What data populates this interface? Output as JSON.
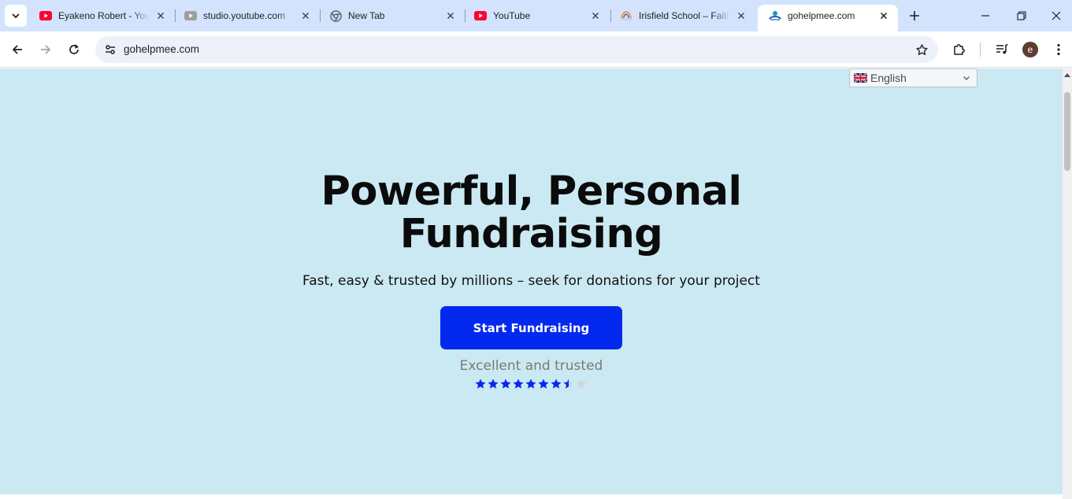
{
  "browser": {
    "tabs": [
      {
        "title": "Eyakeno Robert - YouTube",
        "favicon": "youtube-icon",
        "active": false
      },
      {
        "title": "studio.youtube.com",
        "favicon": "youtube-studio-icon",
        "active": false
      },
      {
        "title": "New Tab",
        "favicon": "chrome-icon",
        "active": false
      },
      {
        "title": "YouTube",
        "favicon": "youtube-icon",
        "active": false
      },
      {
        "title": "Irisfield School – Faith",
        "favicon": "irisfield-icon",
        "active": false
      },
      {
        "title": "gohelpmee.com",
        "favicon": "gohelpmee-icon",
        "active": true
      }
    ],
    "url": "gohelpmee.com",
    "profile_initial": "e",
    "colors": {
      "tabstrip": "#d3e3fd",
      "omnibox": "#edf2fa",
      "avatar": "#5e3d32"
    }
  },
  "page": {
    "language_selector": {
      "selected": "English",
      "flag": "uk-flag-icon"
    },
    "hero": {
      "title_line1": "Powerful, Personal",
      "title_line2": "Fundraising",
      "subtitle": "Fast, easy & trusted by millions – seek for donations for your project",
      "cta_label": "Start Fundraising",
      "trust_text": "Excellent and trusted",
      "rating": 7.5,
      "rating_max": 9
    },
    "colors": {
      "background": "#cbe9f2",
      "cta": "#0429ee",
      "star_filled": "#0429ee",
      "star_empty": "#d5d5d5"
    }
  }
}
